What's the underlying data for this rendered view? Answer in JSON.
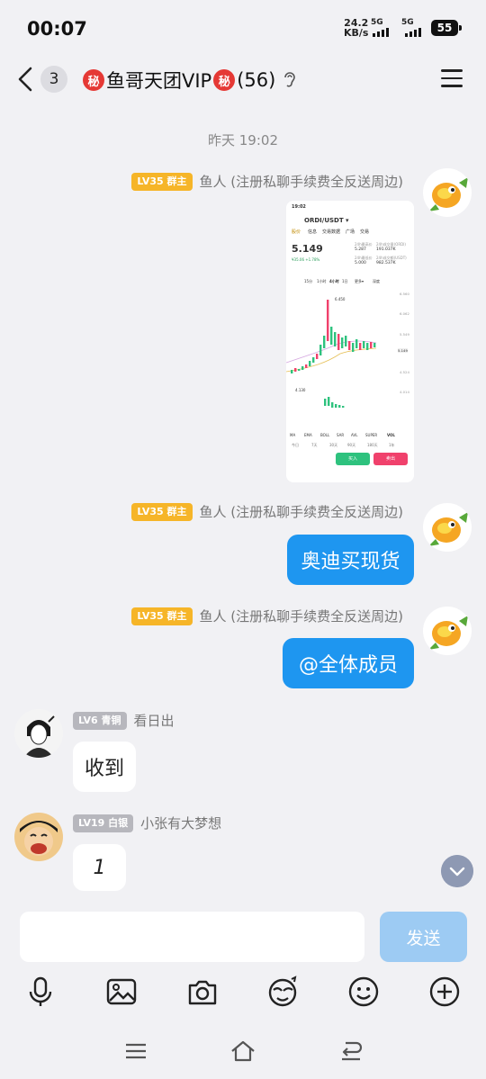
{
  "status": {
    "time": "00:07",
    "net_speed": "24.2",
    "net_unit": "KB/s",
    "sim1": "5G",
    "sim2": "5G",
    "battery": "55"
  },
  "header": {
    "unread": "3",
    "badge_char": "秘",
    "group_name": "鱼哥天团VIP",
    "member_count": "(56)"
  },
  "timestamp": "昨天 19:02",
  "messages": [
    {
      "level": "LV35 群主",
      "sender": "鱼人 (注册私聊手续费全反送周边)",
      "type": "image"
    },
    {
      "level": "LV35 群主",
      "sender": "鱼人 (注册私聊手续费全反送周边)",
      "text": "奥迪买现货"
    },
    {
      "level": "LV35 群主",
      "sender": "鱼人 (注册私聊手续费全反送周边)",
      "text": "@全体成员"
    },
    {
      "level": "LV6 青铜",
      "sender": "看日出",
      "text": "收到"
    },
    {
      "level": "LV19 白银",
      "sender": "小张有大梦想",
      "text": "1"
    }
  ],
  "screenshot": {
    "time": "19:02",
    "pair": "ORDI/USDT ▾",
    "tabs": [
      "股价",
      "信息",
      "交易数据",
      "广场",
      "交易"
    ],
    "price": "5.149",
    "sub_price": "¥35.06  +1.78%",
    "high_label": "24h最高价",
    "high": "5.287",
    "vol_label": "24h成交量(ORDI)",
    "vol": "191.037K",
    "low_label": "24h最低价",
    "low": "5.000",
    "amt_label": "24h成交额(USDT)",
    "amt": "982.537K",
    "intervals": [
      "15分",
      "1小时",
      "4小时",
      "1日",
      "更多▾",
      "深度"
    ],
    "peak": "6.450",
    "trough": "4.130",
    "ytick": [
      "6.560",
      "6.062",
      "5.549",
      "5.149",
      "4.524",
      "4.014"
    ],
    "indicators": [
      "MA",
      "EMA",
      "BOLL",
      "SAR",
      "AVL",
      "SUPER",
      "VOL"
    ],
    "periods": [
      "今日",
      "7天",
      "30天",
      "90天",
      "180天",
      "1年"
    ],
    "buy": "买入",
    "sell": "卖出"
  },
  "input": {
    "send_label": "发送"
  }
}
